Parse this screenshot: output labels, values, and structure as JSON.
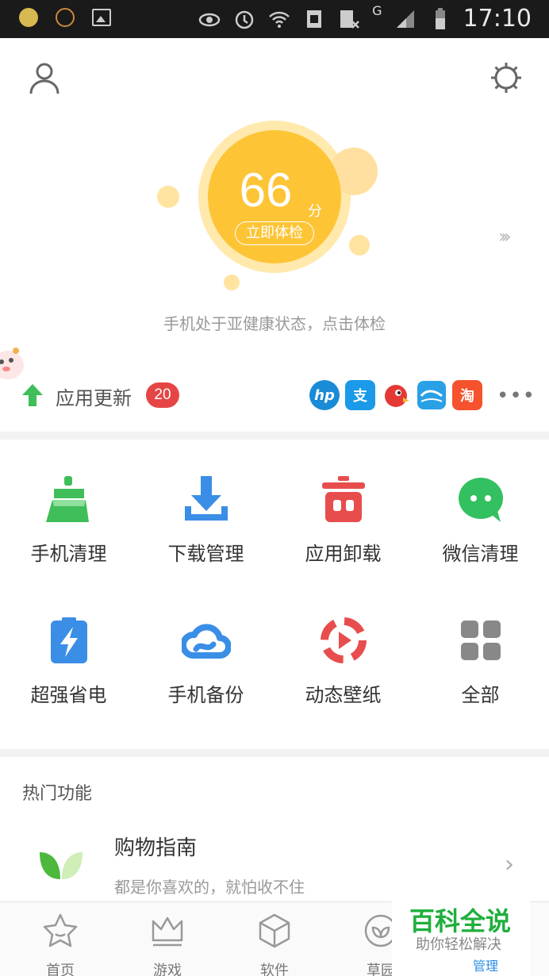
{
  "status_bar": {
    "time": "17:10",
    "network": "G"
  },
  "score": {
    "value": "66",
    "unit": "分",
    "check_button": "立即体检",
    "status_text": "手机处于亚健康状态，点击体检"
  },
  "update": {
    "label": "应用更新",
    "count": "20",
    "apps": [
      {
        "name": "hp-app-icon",
        "text": "hp",
        "color": "#1a8bd6"
      },
      {
        "name": "alipay-icon",
        "text": "支",
        "color": "#1a9ae8"
      },
      {
        "name": "bird-app-icon",
        "text": "",
        "color": "#e53935"
      },
      {
        "name": "cloud-app-icon",
        "text": "",
        "color": "#2aa0e6"
      },
      {
        "name": "taobao-icon",
        "text": "淘",
        "color": "#f5522d"
      }
    ]
  },
  "tools": [
    {
      "label": "手机清理",
      "icon": "broom-icon",
      "color": "#3fbe5a"
    },
    {
      "label": "下载管理",
      "icon": "download-icon",
      "color": "#3a8ee6"
    },
    {
      "label": "应用卸载",
      "icon": "trash-icon",
      "color": "#e84d4d"
    },
    {
      "label": "微信清理",
      "icon": "wechat-icon",
      "color": "#33c060"
    },
    {
      "label": "超强省电",
      "icon": "battery-icon",
      "color": "#3a8ee6"
    },
    {
      "label": "手机备份",
      "icon": "cloud-backup-icon",
      "color": "#3a8ee6"
    },
    {
      "label": "动态壁纸",
      "icon": "video-wallpaper-icon",
      "color": "#e84d4d"
    },
    {
      "label": "全部",
      "icon": "grid-icon",
      "color": "#888888"
    }
  ],
  "hot": {
    "title": "热门功能",
    "item": {
      "title": "购物指南",
      "subtitle": "都是你喜欢的，就怕收不住"
    }
  },
  "nav": [
    {
      "label": "首页",
      "icon": "home-star-icon"
    },
    {
      "label": "游戏",
      "icon": "crown-icon"
    },
    {
      "label": "软件",
      "icon": "box-icon"
    },
    {
      "label": "草园",
      "icon": "leaf-circle-icon"
    },
    {
      "label": "管理",
      "icon": "manage-icon"
    }
  ],
  "watermark": {
    "title": "百科全说",
    "subtitle": "助你轻松解决"
  },
  "colors": {
    "accent": "#fdc436",
    "badge": "#e64545",
    "green": "#3fbe5a"
  }
}
